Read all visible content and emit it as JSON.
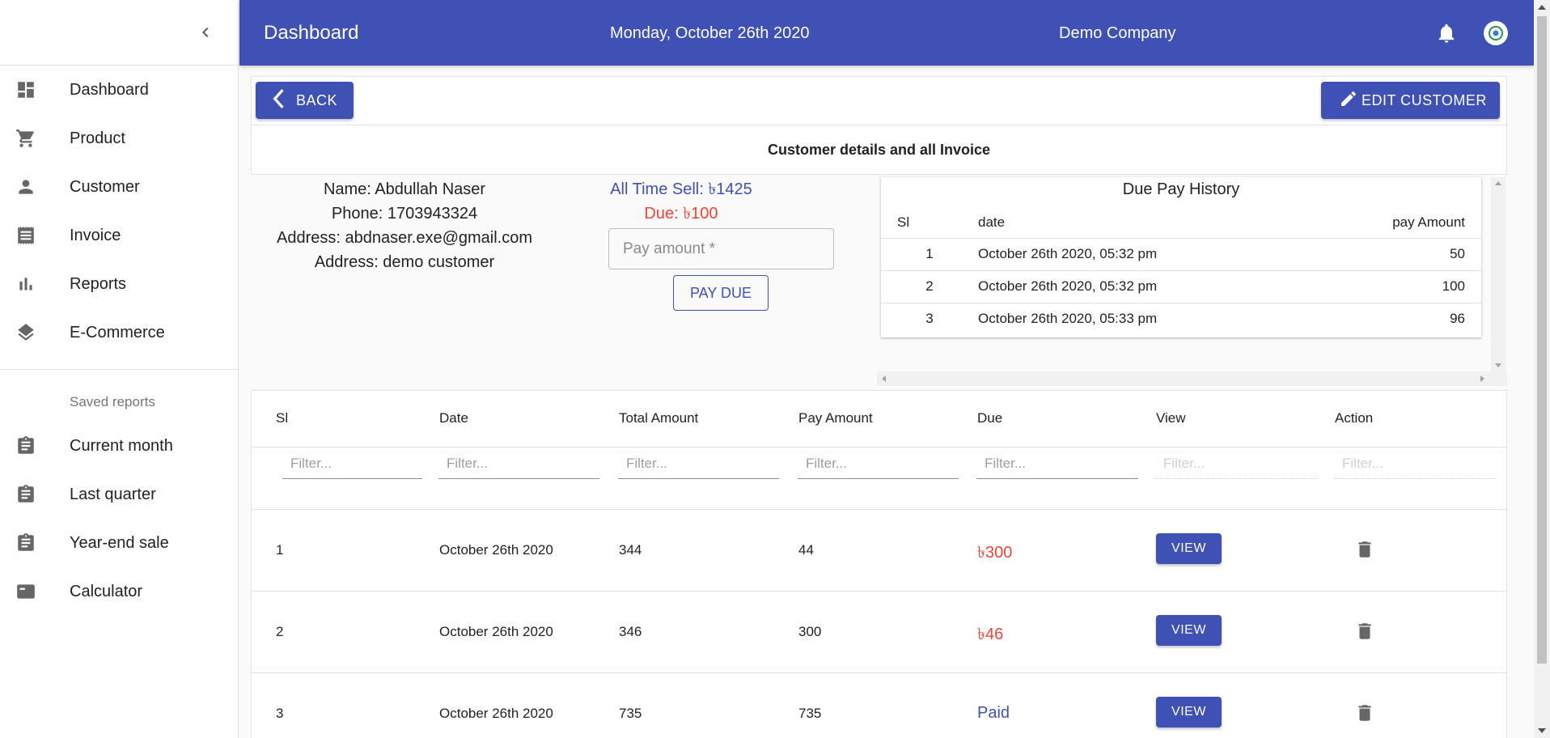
{
  "sidebar": {
    "collapse_icon": "chevron-left-icon",
    "items": [
      {
        "label": "Dashboard",
        "icon": "dashboard-icon"
      },
      {
        "label": "Product",
        "icon": "cart-icon"
      },
      {
        "label": "Customer",
        "icon": "person-icon"
      },
      {
        "label": "Invoice",
        "icon": "receipt-icon"
      },
      {
        "label": "Reports",
        "icon": "bar-chart-icon"
      },
      {
        "label": "E-Commerce",
        "icon": "layers-icon"
      }
    ],
    "saved_header": "Saved reports",
    "saved": [
      {
        "label": "Current month",
        "icon": "assignment-icon"
      },
      {
        "label": "Last quarter",
        "icon": "assignment-icon"
      },
      {
        "label": "Year-end sale",
        "icon": "assignment-icon"
      },
      {
        "label": "Calculator",
        "icon": "calculator-icon"
      }
    ]
  },
  "header": {
    "title": "Dashboard",
    "date": "Monday, October 26th 2020",
    "company": "Demo Company"
  },
  "toolbar": {
    "back_label": "BACK",
    "edit_label": "EDIT CUSTOMER"
  },
  "section_title": "Customer details and all Invoice",
  "customer": {
    "name": "Name: Abdullah Naser",
    "phone": "Phone: 1703943324",
    "email": "Address: abdnaser.exe@gmail.com",
    "address": "Address: demo customer"
  },
  "summary": {
    "all_time_sell": "All Time Sell: ৳1425",
    "due": "Due: ৳100",
    "pay_placeholder": "Pay amount *",
    "pay_due_label": "PAY DUE"
  },
  "due_history": {
    "title": "Due Pay History",
    "columns": [
      "Sl",
      "date",
      "pay Amount"
    ],
    "rows": [
      {
        "sl": "1",
        "date": "October 26th 2020, 05:32 pm",
        "amount": "50"
      },
      {
        "sl": "2",
        "date": "October 26th 2020, 05:32 pm",
        "amount": "100"
      },
      {
        "sl": "3",
        "date": "October 26th 2020, 05:33 pm",
        "amount": "96"
      }
    ]
  },
  "invoices": {
    "columns": [
      "Sl",
      "Date",
      "Total Amount",
      "Pay Amount",
      "Due",
      "View",
      "Action"
    ],
    "filter_placeholder": "Filter...",
    "view_label": "VIEW",
    "rows": [
      {
        "sl": "1",
        "date": "October 26th 2020",
        "total": "344",
        "pay": "44",
        "due": "৳300",
        "due_status": "due"
      },
      {
        "sl": "2",
        "date": "October 26th 2020",
        "total": "346",
        "pay": "300",
        "due": "৳46",
        "due_status": "due"
      },
      {
        "sl": "3",
        "date": "October 26th 2020",
        "total": "735",
        "pay": "735",
        "due": "Paid",
        "due_status": "paid"
      }
    ]
  },
  "colors": {
    "primary": "#3f51b5",
    "due": "#f44336",
    "paid": "#3f51b5"
  }
}
